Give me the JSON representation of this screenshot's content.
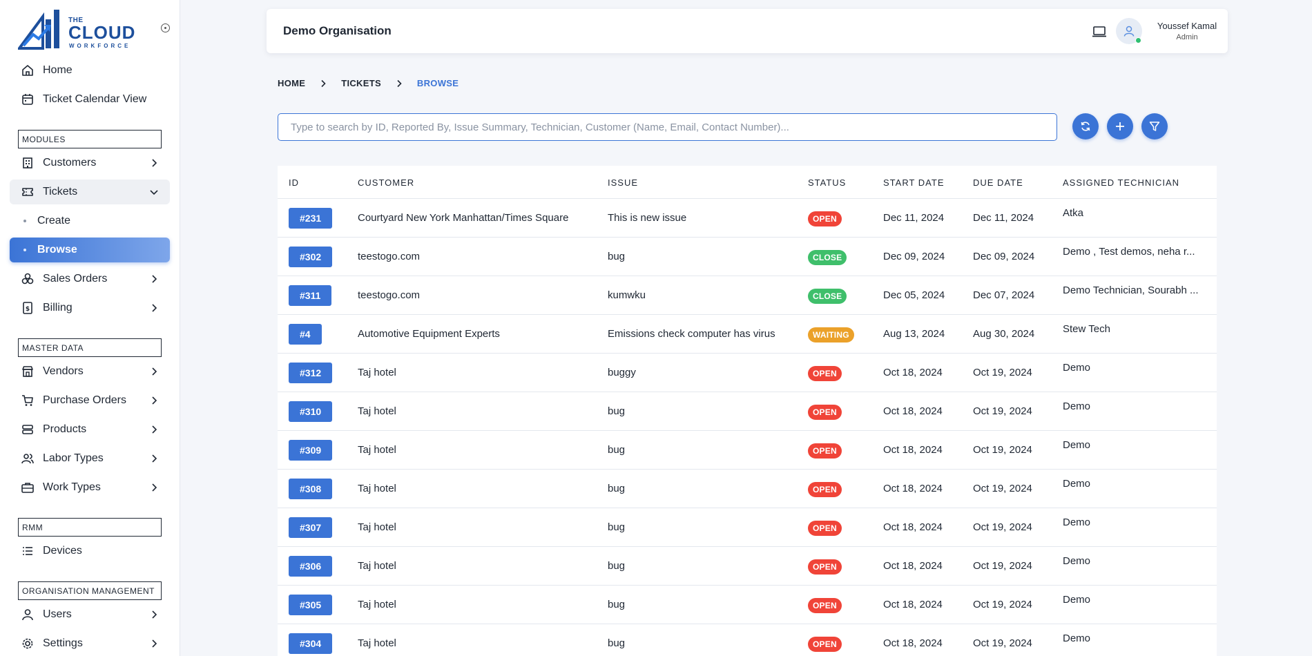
{
  "logo": {
    "the": "THE",
    "cloud": "CLOUD",
    "workforce": "WORKFORCE"
  },
  "sidebar": {
    "top_items": [
      {
        "label": "Home",
        "icon": "home-icon"
      },
      {
        "label": "Ticket Calendar View",
        "icon": "calendar-icon"
      }
    ],
    "sections": {
      "modules": "MODULES",
      "master_data": "MASTER DATA",
      "rmm": "RMM",
      "org_management": "ORGANISATION MANAGEMENT"
    },
    "modules": [
      {
        "label": "Customers",
        "icon": "building-icon"
      },
      {
        "label": "Tickets",
        "icon": "ticket-icon"
      },
      {
        "label": "Create"
      },
      {
        "label": "Browse"
      },
      {
        "label": "Sales Orders",
        "icon": "boxes-icon"
      },
      {
        "label": "Billing",
        "icon": "bill-icon"
      }
    ],
    "master_data": [
      {
        "label": "Vendors",
        "icon": "store-icon"
      },
      {
        "label": "Purchase Orders",
        "icon": "cart-icon"
      },
      {
        "label": "Products",
        "icon": "product-icon"
      },
      {
        "label": "Labor Types",
        "icon": "people-icon"
      },
      {
        "label": "Work Types",
        "icon": "briefcase-icon"
      }
    ],
    "rmm": [
      {
        "label": "Devices",
        "icon": "list-icon"
      }
    ],
    "org_management": [
      {
        "label": "Users",
        "icon": "user-icon"
      },
      {
        "label": "Settings",
        "icon": "gear-icon"
      }
    ]
  },
  "header": {
    "org_name": "Demo Organisation",
    "user_name": "Youssef Kamal",
    "user_role": "Admin"
  },
  "breadcrumb": [
    "HOME",
    "TICKETS",
    "BROWSE"
  ],
  "search": {
    "placeholder": "Type to search by ID, Reported By, Issue Summary, Technician, Customer (Name, Email, Contact Number)...",
    "value": ""
  },
  "colors": {
    "accent": "#3b74d6",
    "open": "#f04438",
    "close": "#3fbf6b",
    "waiting": "#eba12a"
  },
  "table": {
    "headers": [
      "ID",
      "CUSTOMER",
      "ISSUE",
      "STATUS",
      "START DATE",
      "DUE DATE",
      "ASSIGNED TECHNICIAN"
    ],
    "rows": [
      {
        "id": "#231",
        "customer": "Courtyard New York Manhattan/Times Square",
        "issue": "This is new issue",
        "status": "OPEN",
        "start": "Dec 11, 2024",
        "due": "Dec 11, 2024",
        "tech": "Atka"
      },
      {
        "id": "#302",
        "customer": "teestogo.com",
        "issue": "bug",
        "status": "CLOSE",
        "start": "Dec 09, 2024",
        "due": "Dec 09, 2024",
        "tech": "Demo , Test demos, neha r..."
      },
      {
        "id": "#311",
        "customer": "teestogo.com",
        "issue": "kumwku",
        "status": "CLOSE",
        "start": "Dec 05, 2024",
        "due": "Dec 07, 2024",
        "tech": "Demo Technician, Sourabh ..."
      },
      {
        "id": "#4",
        "customer": "Automotive Equipment Experts",
        "issue": "Emissions check computer has virus",
        "status": "WAITING",
        "start": "Aug 13, 2024",
        "due": "Aug 30, 2024",
        "tech": "Stew Tech"
      },
      {
        "id": "#312",
        "customer": "Taj hotel",
        "issue": "buggy",
        "status": "OPEN",
        "start": "Oct 18, 2024",
        "due": "Oct 19, 2024",
        "tech": "Demo"
      },
      {
        "id": "#310",
        "customer": "Taj hotel",
        "issue": "bug",
        "status": "OPEN",
        "start": "Oct 18, 2024",
        "due": "Oct 19, 2024",
        "tech": "Demo"
      },
      {
        "id": "#309",
        "customer": "Taj hotel",
        "issue": "bug",
        "status": "OPEN",
        "start": "Oct 18, 2024",
        "due": "Oct 19, 2024",
        "tech": "Demo"
      },
      {
        "id": "#308",
        "customer": "Taj hotel",
        "issue": "bug",
        "status": "OPEN",
        "start": "Oct 18, 2024",
        "due": "Oct 19, 2024",
        "tech": "Demo"
      },
      {
        "id": "#307",
        "customer": "Taj hotel",
        "issue": "bug",
        "status": "OPEN",
        "start": "Oct 18, 2024",
        "due": "Oct 19, 2024",
        "tech": "Demo"
      },
      {
        "id": "#306",
        "customer": "Taj hotel",
        "issue": "bug",
        "status": "OPEN",
        "start": "Oct 18, 2024",
        "due": "Oct 19, 2024",
        "tech": "Demo"
      },
      {
        "id": "#305",
        "customer": "Taj hotel",
        "issue": "bug",
        "status": "OPEN",
        "start": "Oct 18, 2024",
        "due": "Oct 19, 2024",
        "tech": "Demo"
      },
      {
        "id": "#304",
        "customer": "Taj hotel",
        "issue": "bug",
        "status": "OPEN",
        "start": "Oct 18, 2024",
        "due": "Oct 19, 2024",
        "tech": "Demo"
      }
    ]
  }
}
